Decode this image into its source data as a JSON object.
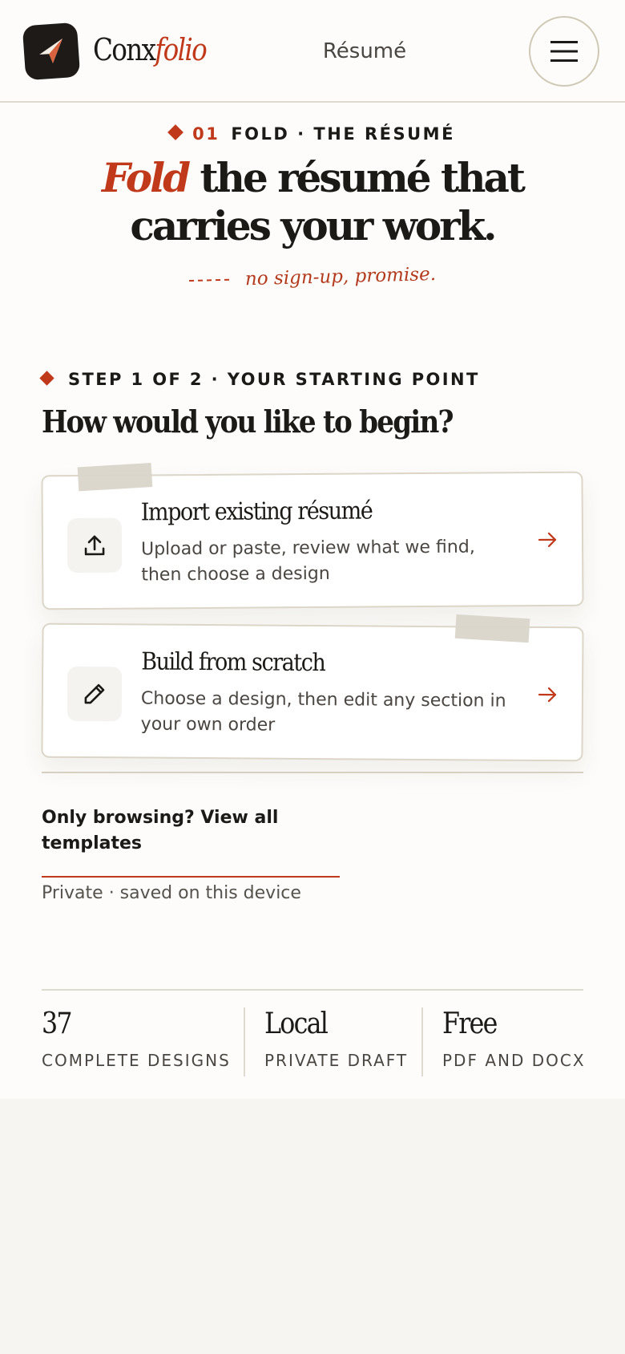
{
  "brand": {
    "name_main": "Conx",
    "name_accent": "folio"
  },
  "nav": {
    "link_label": "Résumé"
  },
  "hero": {
    "eyebrow_number": "01",
    "eyebrow_text": "FOLD · THE RÉSUMÉ",
    "headline_accent": "Fold",
    "headline_rest": "the résumé that carries your work.",
    "handnote": "no sign-up, promise."
  },
  "step": {
    "label": "STEP 1 OF 2 · YOUR STARTING POINT",
    "question": "How would you like to begin?"
  },
  "options": [
    {
      "title": "Import existing résumé",
      "description": "Upload or paste, review what we find, then choose a design",
      "icon": "upload-icon"
    },
    {
      "title": "Build from scratch",
      "description": "Choose a design, then edit any section in your own order",
      "icon": "pencil-icon"
    }
  ],
  "browse": {
    "link_label": "Only browsing? View all templates"
  },
  "privacy_note": "Private · saved on this device",
  "stats": [
    {
      "value": "37",
      "label": "COMPLETE DESIGNS"
    },
    {
      "value": "Local",
      "label": "PRIVATE DRAFT"
    },
    {
      "value": "Free",
      "label": "PDF AND DOCX"
    }
  ],
  "colors": {
    "accent": "#c0391b",
    "ink": "#1c1a17",
    "paper": "#fdfcfa",
    "tape": "#d9d5ca"
  }
}
